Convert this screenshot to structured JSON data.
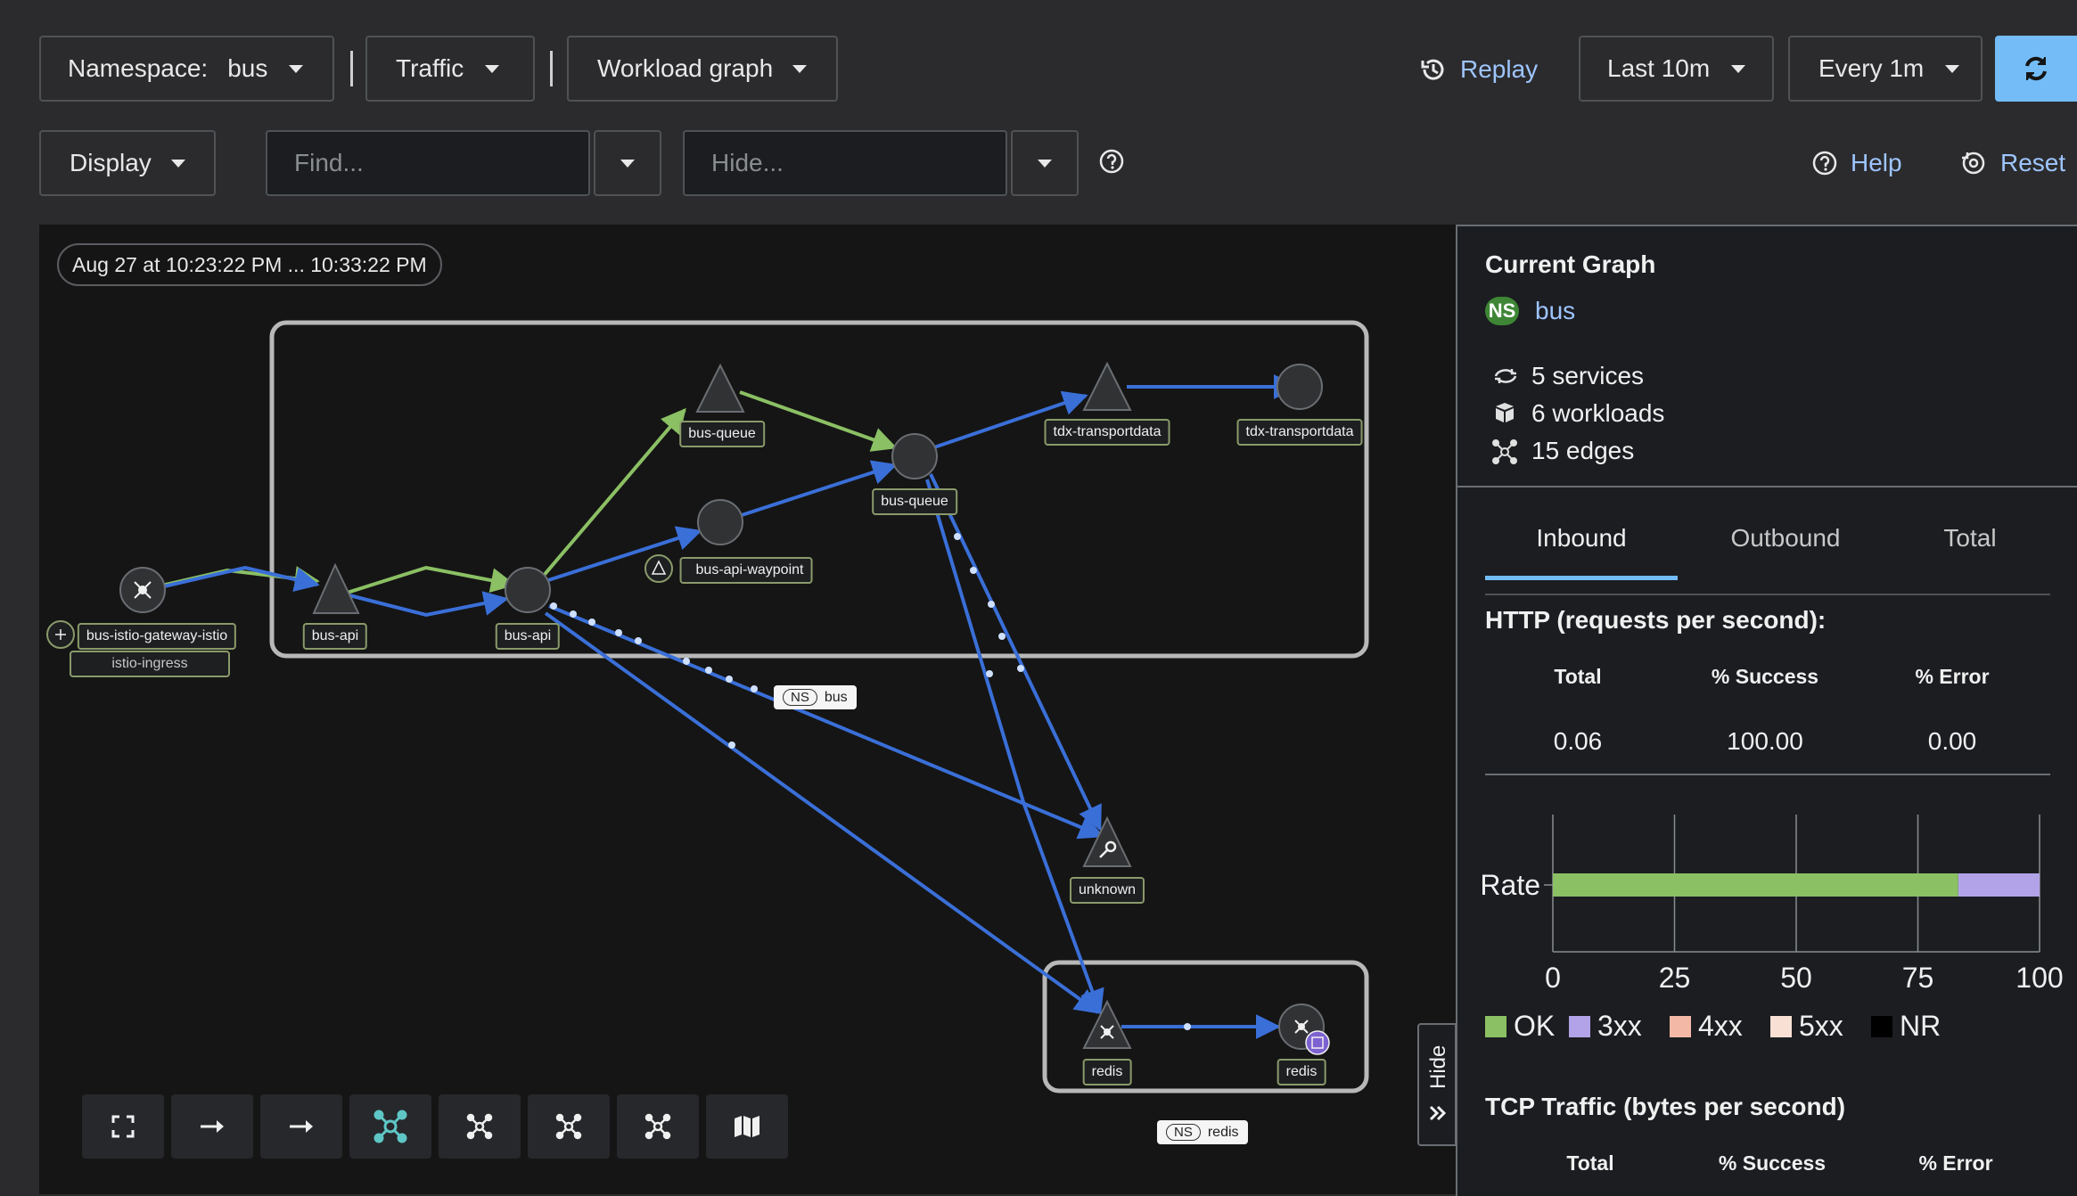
{
  "toolbar": {
    "namespace_label": "Namespace:",
    "namespace_value": "bus",
    "traffic_label": "Traffic",
    "graph_type_label": "Workload graph",
    "replay_label": "Replay",
    "time_range_label": "Last 10m",
    "refresh_interval_label": "Every 1m",
    "display_label": "Display",
    "find_placeholder": "Find...",
    "hide_placeholder": "Hide...",
    "help_label": "Help",
    "reset_label": "Reset"
  },
  "graph": {
    "time_range": "Aug 27 at 10:23:22 PM ... 10:33:22 PM",
    "nodes": {
      "gateway": "bus-istio-gateway-istio",
      "gateway_sub": "istio-ingress",
      "bus_api_service": "bus-api",
      "bus_api_workload": "bus-api",
      "bus_queue_service": "bus-queue",
      "bus_api_waypoint": "bus-api-waypoint",
      "bus_queue_workload": "bus-queue",
      "tdx_service": "tdx-transportdata",
      "tdx_workload": "tdx-transportdata",
      "unknown": "unknown",
      "redis_service": "redis",
      "redis_workload": "redis"
    },
    "namespaces": {
      "ns_badge": "NS",
      "bus": "bus",
      "redis": "redis"
    },
    "hide_label": "Hide"
  },
  "panel": {
    "title": "Current Graph",
    "ns_badge": "NS",
    "namespace": "bus",
    "services": "5 services",
    "workloads": "6 workloads",
    "edges": "15 edges",
    "tabs": [
      "Inbound",
      "Outbound",
      "Total"
    ],
    "active_tab": "Inbound",
    "http_title": "HTTP (requests per second):",
    "http_headers": [
      "Total",
      "% Success",
      "% Error"
    ],
    "http_values": [
      "0.06",
      "100.00",
      "0.00"
    ],
    "tcp_title": "TCP Traffic (bytes per second)",
    "tcp_headers": [
      "Total",
      "% Success",
      "% Error"
    ]
  },
  "chart_data": {
    "type": "bar",
    "orientation": "horizontal",
    "categories": [
      "Rate"
    ],
    "series": [
      {
        "name": "OK",
        "values": [
          83.3
        ],
        "color": "#8bc064"
      },
      {
        "name": "3xx",
        "values": [
          16.7
        ],
        "color": "#b2a3e8"
      },
      {
        "name": "4xx",
        "values": [
          0
        ],
        "color": "#f4b9a6"
      },
      {
        "name": "5xx",
        "values": [
          0
        ],
        "color": "#f9e0d5"
      },
      {
        "name": "NR",
        "values": [
          0
        ],
        "color": "#000000"
      }
    ],
    "xlim": [
      0,
      100
    ],
    "ticks": [
      "0",
      "25",
      "50",
      "75",
      "100"
    ],
    "stacked": true,
    "legend_position": "bottom"
  },
  "colors": {
    "accent": "#73bcf7",
    "edge_blue": "#3a6fd8",
    "edge_green": "#8bc064",
    "ns_green": "#3e8635"
  }
}
